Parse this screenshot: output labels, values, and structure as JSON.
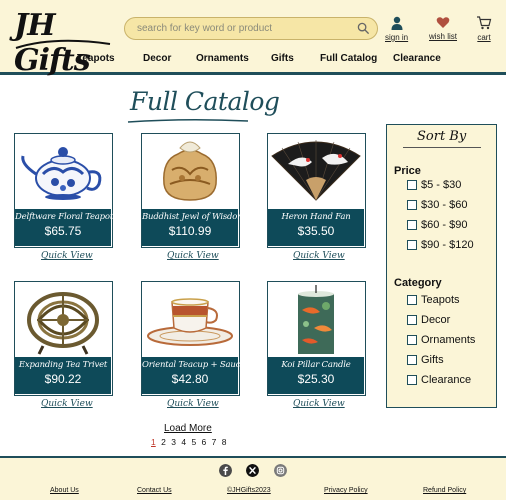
{
  "header": {
    "logo_text": "JH Gifts",
    "search": {
      "placeholder": "search for key word or product"
    },
    "utilities": [
      {
        "label": "sign in",
        "icon": "user-icon"
      },
      {
        "label": "wish list",
        "icon": "heart-icon"
      },
      {
        "label": "cart",
        "icon": "cart-icon"
      }
    ],
    "nav": [
      "Teapots",
      "Decor",
      "Ornaments",
      "Gifts",
      "Full Catalog",
      "Clearance"
    ]
  },
  "main": {
    "title": "Full Catalog",
    "products": [
      {
        "name": "Delftware Floral Teapot",
        "price": "$65.75",
        "quick_view": "Quick View"
      },
      {
        "name": "Buddhist Jewl of Wisdom",
        "price": "$110.99",
        "quick_view": "Quick View"
      },
      {
        "name": "Heron Hand Fan",
        "price": "$35.50",
        "quick_view": "Quick View"
      },
      {
        "name": "Expanding Tea Trivet",
        "price": "$90.22",
        "quick_view": "Quick View"
      },
      {
        "name": "Oriental Teacup + Saucer",
        "price": "$42.80",
        "quick_view": "Quick View"
      },
      {
        "name": "Koi Pillar Candle",
        "price": "$25.30",
        "quick_view": "Quick View"
      }
    ],
    "load_more": "Load More",
    "pagination": [
      "1",
      "2",
      "3",
      "4",
      "5",
      "6",
      "7",
      "8"
    ],
    "current_page": "1"
  },
  "sidebar": {
    "sort_by": "Sort By",
    "price_heading": "Price",
    "price_options": [
      "$5 - $30",
      "$30 - $60",
      "$60 - $90",
      "$90 - $120"
    ],
    "category_heading": "Category",
    "category_options": [
      "Teapots",
      "Decor",
      "Ornaments",
      "Gifts",
      "Clearance"
    ]
  },
  "footer": {
    "social": [
      "facebook-icon",
      "x-icon",
      "instagram-icon"
    ],
    "links": [
      "About Us",
      "Contact Us",
      "©JHGifts2023",
      "Privacy Policy",
      "Refund Policy"
    ]
  },
  "colors": {
    "accent": "#0e4a59",
    "header_bg": "#fbf5d7",
    "search_bg": "#f6e6a6"
  }
}
